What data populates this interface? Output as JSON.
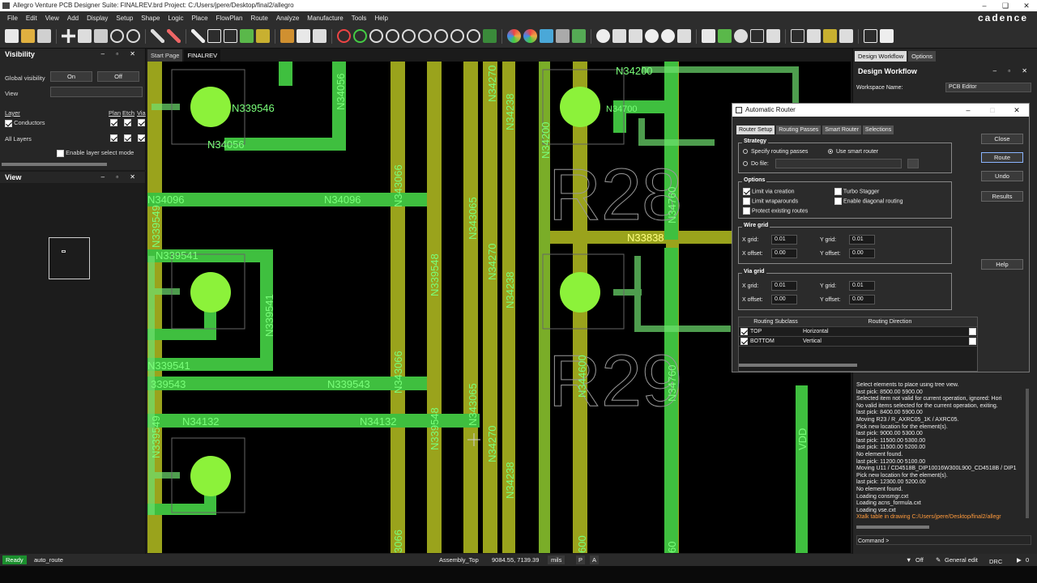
{
  "window": {
    "title": "Allegro Venture PCB Designer Suite: FINALREV.brd  Project: C:/Users/jpere/Desktop/final2/allegro"
  },
  "menu": [
    "File",
    "Edit",
    "View",
    "Add",
    "Display",
    "Setup",
    "Shape",
    "Logic",
    "Place",
    "FlowPlan",
    "Route",
    "Analyze",
    "Manufacture",
    "Tools",
    "Help"
  ],
  "brand": "cadence",
  "visibility": {
    "title": "Visibility",
    "global_label": "Global visibility",
    "on": "On",
    "off": "Off",
    "view_label": "View",
    "layer_label": "Layer",
    "cols": [
      "Plan",
      "Etch",
      "Via"
    ],
    "conductors": "Conductors",
    "all_layers": "All Layers",
    "enable_layer_select": "Enable layer select mode"
  },
  "view_panel": {
    "title": "View"
  },
  "tabs": {
    "start": "Start Page",
    "active": "FINALREV"
  },
  "nets": {
    "n339546": "N339546",
    "n34056": "N34056",
    "n34096a": "N34096",
    "n34096b": "N34096",
    "n339541a": "N339541",
    "n339541b": "N339541",
    "n339541c": "N339541",
    "n339543a": "339543",
    "n339543b": "N339543",
    "n34132a": "N34132",
    "n34132b": "N34132",
    "n339549a": "N339549",
    "n339549b": "N339549",
    "n343066a": "N343066",
    "n343066b": "N343066",
    "n343065": "N343065",
    "n339548": "N339548",
    "n34270a": "N34270",
    "n34270b": "N34270",
    "n34270c": "N34270",
    "n34238a": "N34238",
    "n34238b": "N34238",
    "n34238c": "N34238",
    "n34200a": "N34200",
    "n34200b": "N34200",
    "n33838": "N33838",
    "n34760a": "N34760",
    "n34760b": "N34760",
    "n344600": "N344600",
    "n34700": "N34700",
    "vdd": "VDD",
    "n3066": "3066",
    "n600": "600",
    "n60": "60"
  },
  "refdes": [
    "R28",
    "R29"
  ],
  "workflow": {
    "tab_workflow": "Design Workflow",
    "tab_options": "Options",
    "title": "Design Workflow",
    "workspace_label": "Workspace Name:",
    "workspace_value": "PCB Editor"
  },
  "console": [
    "Select elements to place using tree view.",
    "last pick:  8500.00 5900.00",
    "Selected item not valid for current operation, ignored: Hori",
    "No valid items selected for the current operation, exiting.",
    "last pick:  8400.00 5900.00",
    "Moving R23 / R_AXRC05_1K / AXRC05.",
    "Pick new location for the element(s).",
    "last pick:  9000.00 5300.00",
    "last pick:  11500.00 5300.00",
    "last pick:  11500.00 5200.00",
    "No element found.",
    "last pick:  11200.00 5100.00",
    "Moving U11 / CD4518B_DIP10016W300L900_CD4518B / DIP1",
    "Pick new location for the element(s).",
    "last pick:  12300.00 5200.00",
    "No element found.",
    "Loading consmgr.cxt",
    "Loading acns_formula.cxt",
    "Loading vse.cxt",
    "Xtalk table in drawing C:/Users/jpere/Desktop/final2/allegr"
  ],
  "command_label": "Command >",
  "router": {
    "title": "Automatic Router",
    "tabs": [
      "Router Setup",
      "Routing Passes",
      "Smart Router",
      "Selections"
    ],
    "strategy": "Strategy",
    "specify_passes": "Specify routing passes",
    "use_smart": "Use smart router",
    "do_file": "Do file:",
    "options": "Options",
    "limit_via": "Limit via creation",
    "turbo": "Turbo Stagger",
    "limit_wrap": "Limit wraparounds",
    "diag": "Enable diagonal routing",
    "protect": "Protect existing routes",
    "wire_grid": "Wire grid",
    "via_grid": "Via grid",
    "x_grid": "X grid:",
    "y_grid": "Y grid:",
    "x_offset": "X offset:",
    "y_offset": "Y offset:",
    "wire": {
      "x_grid": "0.01",
      "y_grid": "0.01",
      "x_offset": "0.00",
      "y_offset": "0.00"
    },
    "via": {
      "x_grid": "0.01",
      "y_grid": "0.01",
      "x_offset": "0.00",
      "y_offset": "0.00"
    },
    "col_subclass": "Routing Subclass",
    "col_direction": "Routing Direction",
    "rows": [
      {
        "subclass": "TOP",
        "direction": "Horizontal"
      },
      {
        "subclass": "BOTTOM",
        "direction": "Vertical"
      }
    ],
    "buttons": {
      "close": "Close",
      "route": "Route",
      "undo": "Undo",
      "results": "Results",
      "help": "Help"
    }
  },
  "status": {
    "ready": "Ready",
    "command": "auto_route",
    "layer": "Assembly_Top",
    "coords": "9084.55, 7139.39",
    "units": "mils",
    "p": "P",
    "a": "A",
    "filter": "Off",
    "mode": "General edit",
    "drc": "DRC",
    "count": "0"
  },
  "colors": {
    "trace_green": "#3fbf3f",
    "trace_olive": "#9aa31c",
    "pad": "#8cf23a",
    "dark_green": "#0f4d0f"
  }
}
